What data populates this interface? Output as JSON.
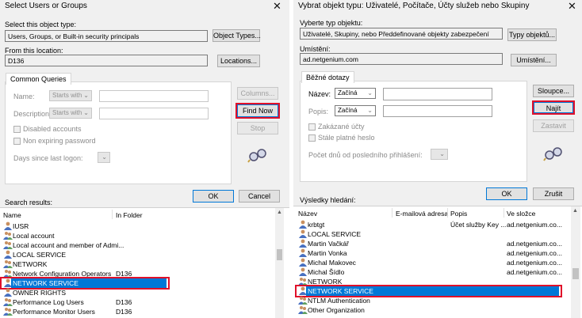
{
  "left": {
    "title": "Select Users or Groups",
    "object_type_label": "Select this object type:",
    "object_type_value": "Users, Groups, or Built-in security principals",
    "object_types_btn": "Object Types...",
    "location_label": "From this location:",
    "location_value": "D136",
    "locations_btn": "Locations...",
    "tab": "Common Queries",
    "name_label": "Name:",
    "description_label": "Description:",
    "starts_with": "Starts with",
    "disabled_accounts": "Disabled accounts",
    "non_expiring": "Non expiring password",
    "days_since": "Days since last logon:",
    "columns_btn": "Columns...",
    "find_now_btn": "Find Now",
    "stop_btn": "Stop",
    "ok_btn": "OK",
    "cancel_btn": "Cancel",
    "search_results": "Search results:",
    "columns": [
      "Name",
      "In Folder"
    ],
    "rows": [
      {
        "name": "IUSR",
        "folder": ""
      },
      {
        "name": "Local account",
        "folder": ""
      },
      {
        "name": "Local account and member of Admi...",
        "folder": ""
      },
      {
        "name": "LOCAL SERVICE",
        "folder": ""
      },
      {
        "name": "NETWORK",
        "folder": ""
      },
      {
        "name": "Network Configuration Operators",
        "folder": "D136"
      },
      {
        "name": "NETWORK SERVICE",
        "folder": ""
      },
      {
        "name": "OWNER RIGHTS",
        "folder": ""
      },
      {
        "name": "Performance Log Users",
        "folder": "D136"
      },
      {
        "name": "Performance Monitor Users",
        "folder": "D136"
      }
    ]
  },
  "right": {
    "title": "Vybrat objekt typu: Uživatelé, Počítače, Účty služeb nebo Skupiny",
    "object_type_label": "Vyberte typ objektu:",
    "object_type_value": "Uživatelé, Skupiny, nebo Předdefinované objekty zabezpečení",
    "object_types_btn": "Typy objektů...",
    "location_label": "Umístění:",
    "location_value": "ad.netgenium.com",
    "locations_btn": "Umístění...",
    "tab": "Běžné dotazy",
    "name_label": "Název:",
    "description_label": "Popis:",
    "starts_with": "Začíná",
    "disabled_accounts": "Zakázané účty",
    "non_expiring": "Stále platné heslo",
    "days_since": "Počet dnů od posledního přihlášení:",
    "columns_btn": "Sloupce...",
    "find_now_btn": "Najít",
    "stop_btn": "Zastavit",
    "ok_btn": "OK",
    "cancel_btn": "Zrušit",
    "search_results": "Výsledky hledání:",
    "columns": [
      "Název",
      "E-mailová adresa",
      "Popis",
      "Ve složce"
    ],
    "rows": [
      {
        "name": "krbtgt",
        "email": "",
        "desc": "Účet služby Key ...",
        "folder": "ad.netgenium.co..."
      },
      {
        "name": "LOCAL SERVICE",
        "email": "",
        "desc": "",
        "folder": ""
      },
      {
        "name": "Martin Vačkář",
        "email": "",
        "desc": "",
        "folder": "ad.netgenium.co..."
      },
      {
        "name": "Martin Vonka",
        "email": "",
        "desc": "",
        "folder": "ad.netgenium.co..."
      },
      {
        "name": "Michal Makovec",
        "email": "",
        "desc": "",
        "folder": "ad.netgenium.co..."
      },
      {
        "name": "Michal Šídlo",
        "email": "",
        "desc": "",
        "folder": "ad.netgenium.co..."
      },
      {
        "name": "NETWORK",
        "email": "",
        "desc": "",
        "folder": ""
      },
      {
        "name": "NETWORK SERVICE",
        "email": "",
        "desc": "",
        "folder": ""
      },
      {
        "name": "NTLM Authentication",
        "email": "",
        "desc": "",
        "folder": ""
      },
      {
        "name": "Other Organization",
        "email": "",
        "desc": "",
        "folder": ""
      }
    ]
  },
  "icons": {
    "close": "close-icon",
    "search": "search-glasses-icon",
    "user": "user-icon",
    "group": "group-icon"
  },
  "colors": {
    "selection": "#0078d7",
    "highlight": "#e0102a"
  }
}
